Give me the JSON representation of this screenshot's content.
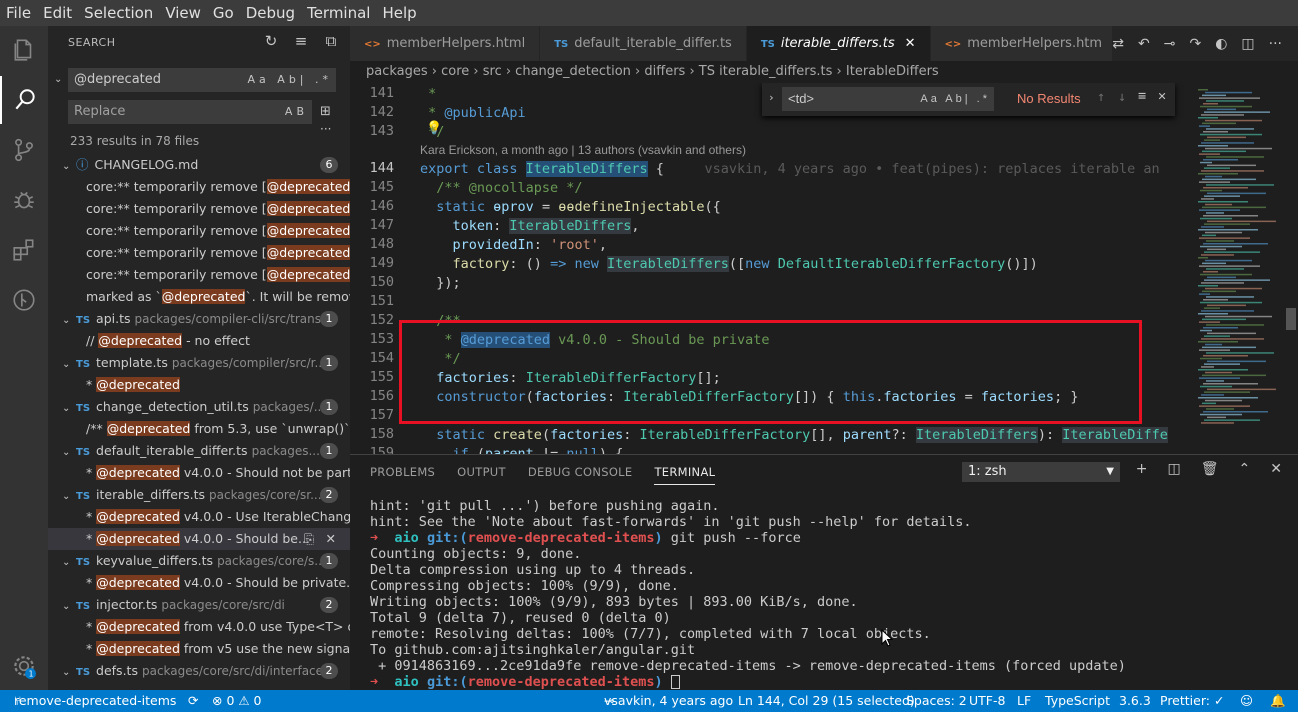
{
  "menu": [
    "File",
    "Edit",
    "Selection",
    "View",
    "Go",
    "Debug",
    "Terminal",
    "Help"
  ],
  "sidebar": {
    "title": "SEARCH",
    "search_value": "@deprecated",
    "search_opts": "Aa  Ab|  .*",
    "replace_placeholder": "Replace",
    "replace_opts": "AB",
    "results": "233 results in 78 files"
  },
  "tree": [
    {
      "k": "file",
      "name": "CHANGELOG.md",
      "path": "",
      "count": "6",
      "icon": "changelog"
    },
    {
      "k": "m",
      "pre": "core:** temporarily remove [",
      "hit": "@deprecated",
      "post": "..."
    },
    {
      "k": "m",
      "pre": "core:** temporarily remove [",
      "hit": "@deprecated",
      "post": "..."
    },
    {
      "k": "m",
      "pre": "core:** temporarily remove [",
      "hit": "@deprecated",
      "post": "..."
    },
    {
      "k": "m",
      "pre": "core:** temporarily remove [",
      "hit": "@deprecated",
      "post": "..."
    },
    {
      "k": "m",
      "pre": "core:** temporarily remove [",
      "hit": "@deprecated",
      "post": "..."
    },
    {
      "k": "m",
      "pre": "marked as `",
      "hit": "@deprecated",
      "post": "`. It will be remov..."
    },
    {
      "k": "file",
      "name": "api.ts",
      "path": "packages/compiler-cli/src/trans...",
      "count": "1",
      "icon": "TS"
    },
    {
      "k": "m",
      "pre": "// ",
      "hit": "@deprecated",
      "post": " - no effect"
    },
    {
      "k": "file",
      "name": "template.ts",
      "path": "packages/compiler/src/r...",
      "count": "1",
      "icon": "TS"
    },
    {
      "k": "m",
      "pre": "* ",
      "hit": "@deprecated",
      "post": ""
    },
    {
      "k": "file",
      "name": "change_detection_util.ts",
      "path": "packages/...",
      "count": "1",
      "icon": "TS"
    },
    {
      "k": "m",
      "pre": "/** ",
      "hit": "@deprecated",
      "post": " from 5.3, use `unwrap()` ..."
    },
    {
      "k": "file",
      "name": "default_iterable_differ.ts",
      "path": "packages...",
      "count": "1",
      "icon": "TS"
    },
    {
      "k": "m",
      "pre": "* ",
      "hit": "@deprecated",
      "post": " v4.0.0 - Should not be part ..."
    },
    {
      "k": "file",
      "name": "iterable_differs.ts",
      "path": "packages/core/sr...",
      "count": "2",
      "icon": "TS"
    },
    {
      "k": "m",
      "pre": "* ",
      "hit": "@deprecated",
      "post": " v4.0.0 - Use IterableChang..."
    },
    {
      "k": "m",
      "pre": "* ",
      "hit": "@deprecated",
      "post": " v4.0.0 - Should be...",
      "sel": true
    },
    {
      "k": "file",
      "name": "keyvalue_differs.ts",
      "path": "packages/core/s...",
      "count": "1",
      "icon": "TS"
    },
    {
      "k": "m",
      "pre": "* ",
      "hit": "@deprecated",
      "post": " v4.0.0 - Should be private."
    },
    {
      "k": "file",
      "name": "injector.ts",
      "path": "packages/core/src/di",
      "count": "2",
      "icon": "TS"
    },
    {
      "k": "m",
      "pre": "* ",
      "hit": "@deprecated",
      "post": " from v4.0.0 use Type<T> o..."
    },
    {
      "k": "m",
      "pre": "* ",
      "hit": "@deprecated",
      "post": " from v5 use the new signa..."
    },
    {
      "k": "file",
      "name": "defs.ts",
      "path": "packages/core/src/di/interface",
      "count": "2",
      "icon": "TS"
    }
  ],
  "tabs": [
    {
      "icon": "<>",
      "type": "html",
      "label": "memberHelpers.html",
      "active": false
    },
    {
      "icon": "TS",
      "type": "ts",
      "label": "default_iterable_differ.ts",
      "active": false
    },
    {
      "icon": "TS",
      "type": "ts",
      "label": "iterable_differs.ts",
      "active": true
    },
    {
      "icon": "<>",
      "type": "html",
      "label": "memberHelpers.htm",
      "active": false
    }
  ],
  "breadcrumb": "packages › core › src › change_detection › differs › TS iterable_differs.ts › IterableDiffers",
  "find": {
    "value": "<td>",
    "opts": "Aa  Ab|  .*",
    "result": "No Results"
  },
  "blame": "Kara Erickson, a month ago | 13 authors (vsavkin and others)",
  "ghost": "vsavkin, 4 years ago • feat(pipes): replaces iterable an",
  "lines": [
    "141",
    "142",
    "143",
    "144",
    "145",
    "146",
    "147",
    "148",
    "149",
    "150",
    "151",
    "152",
    "153",
    "154",
    "155",
    "156",
    "157",
    "158",
    "159"
  ],
  "panel": {
    "tabs": [
      "PROBLEMS",
      "OUTPUT",
      "DEBUG CONSOLE",
      "TERMINAL"
    ],
    "terminal_select": "1: zsh"
  },
  "term": {
    "l1": "hint: 'git pull ...') before pushing again.",
    "l2": "hint: See the 'Note about fast-forwards' in 'git push --help' for details.",
    "prompt_arrow": "➜",
    "prompt_dir": "aio",
    "prompt_git": "git:(",
    "prompt_branch": "remove-deprecated-items",
    "prompt_close": ")",
    "cmd": " git push --force",
    "l4": "Counting objects: 9, done.",
    "l5": "Delta compression using up to 4 threads.",
    "l6": "Compressing objects: 100% (9/9), done.",
    "l7": "Writing objects: 100% (9/9), 893 bytes | 893.00 KiB/s, done.",
    "l8": "Total 9 (delta 7), reused 0 (delta 0)",
    "l9": "remote: Resolving deltas: 100% (7/7), completed with 7 local objects.",
    "l10": "To github.com:ajitsinghkaler/angular.git",
    "l11": " + 0914863169...2ce91da9fe remove-deprecated-items -> remove-deprecated-items (forced update)"
  },
  "status": {
    "branch": "remove-deprecated-items",
    "errors": "⊗ 0 ⚠ 0",
    "blame": "vsavkin, 4 years ago",
    "pos": "Ln 144, Col 29 (15 selected)",
    "spaces": "Spaces: 2",
    "enc": "UTF-8",
    "eol": "LF",
    "lang": "TypeScript",
    "ver": "3.6.3",
    "prettier": "Prettier: ✓"
  }
}
